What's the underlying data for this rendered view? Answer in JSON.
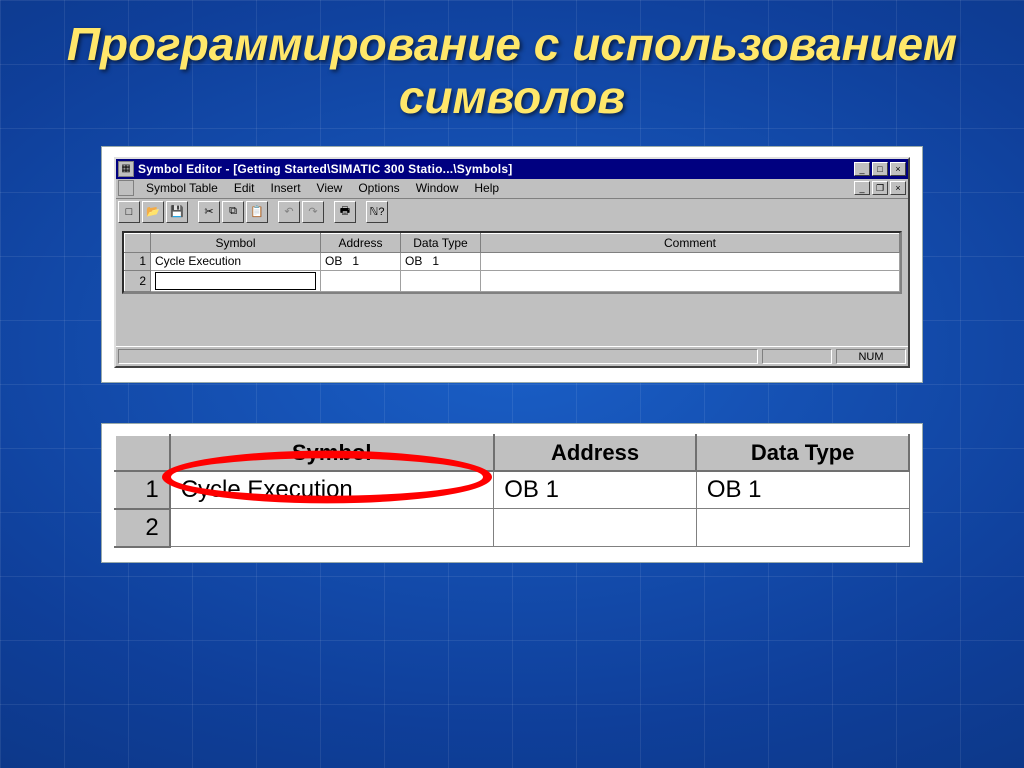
{
  "slide": {
    "title": "Программирование с использованием символов"
  },
  "window": {
    "title": "Symbol Editor - [Getting Started\\SIMATIC 300 Statio...\\Symbols]",
    "menus": [
      "Symbol Table",
      "Edit",
      "Insert",
      "View",
      "Options",
      "Window",
      "Help"
    ],
    "status": {
      "num": "NUM"
    },
    "toolbar_icons": [
      "new",
      "open",
      "save",
      "",
      "cut",
      "copy",
      "paste",
      "",
      "undo",
      "redo",
      "",
      "print",
      "",
      "help-context"
    ]
  },
  "grid": {
    "headers": {
      "symbol": "Symbol",
      "address": "Address",
      "datatype": "Data Type",
      "comment": "Comment"
    },
    "rows": [
      {
        "n": "1",
        "symbol": "Cycle Execution",
        "addr_type": "OB",
        "addr_no": "1",
        "dt_type": "OB",
        "dt_no": "1",
        "comment": ""
      },
      {
        "n": "2",
        "symbol": "",
        "addr_type": "",
        "addr_no": "",
        "dt_type": "",
        "dt_no": "",
        "comment": ""
      }
    ]
  },
  "zoom": {
    "headers": {
      "symbol": "Symbol",
      "address": "Address",
      "datatype": "Data Type"
    },
    "rows": [
      {
        "n": "1",
        "symbol": "Cycle Execution",
        "addr": "OB     1",
        "datatype": "OB     1"
      },
      {
        "n": "2",
        "symbol": "",
        "addr": "",
        "datatype": ""
      }
    ]
  }
}
